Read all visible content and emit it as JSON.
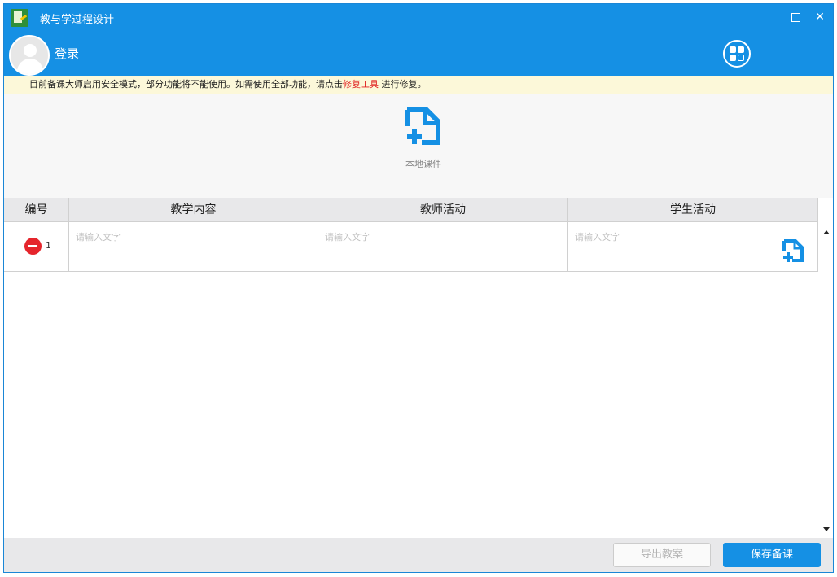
{
  "window": {
    "title": "教与学过程设计"
  },
  "user": {
    "login_label": "登录"
  },
  "notice": {
    "text_before": "目前备课大师启用安全模式，部分功能将不能使用。如需使用全部功能，请点击",
    "link_text": "修复工具",
    "text_after": " 进行修复。"
  },
  "upload": {
    "label": "本地课件"
  },
  "table": {
    "headers": [
      "编号",
      "教学内容",
      "教师活动",
      "学生活动"
    ],
    "rows": [
      {
        "number": "1",
        "placeholder": "请输入文字"
      }
    ]
  },
  "footer": {
    "export_label": "导出教案",
    "save_label": "保存备课"
  },
  "colors": {
    "primary": "#1590e4",
    "danger": "#e5252c",
    "link": "#e01e1e",
    "notice_bg": "#fcf8d9"
  },
  "icons": [
    "app-icon",
    "avatar",
    "grid-menu-icon",
    "file-add-icon",
    "remove-row-icon",
    "minimize-icon",
    "maximize-icon",
    "close-icon"
  ]
}
